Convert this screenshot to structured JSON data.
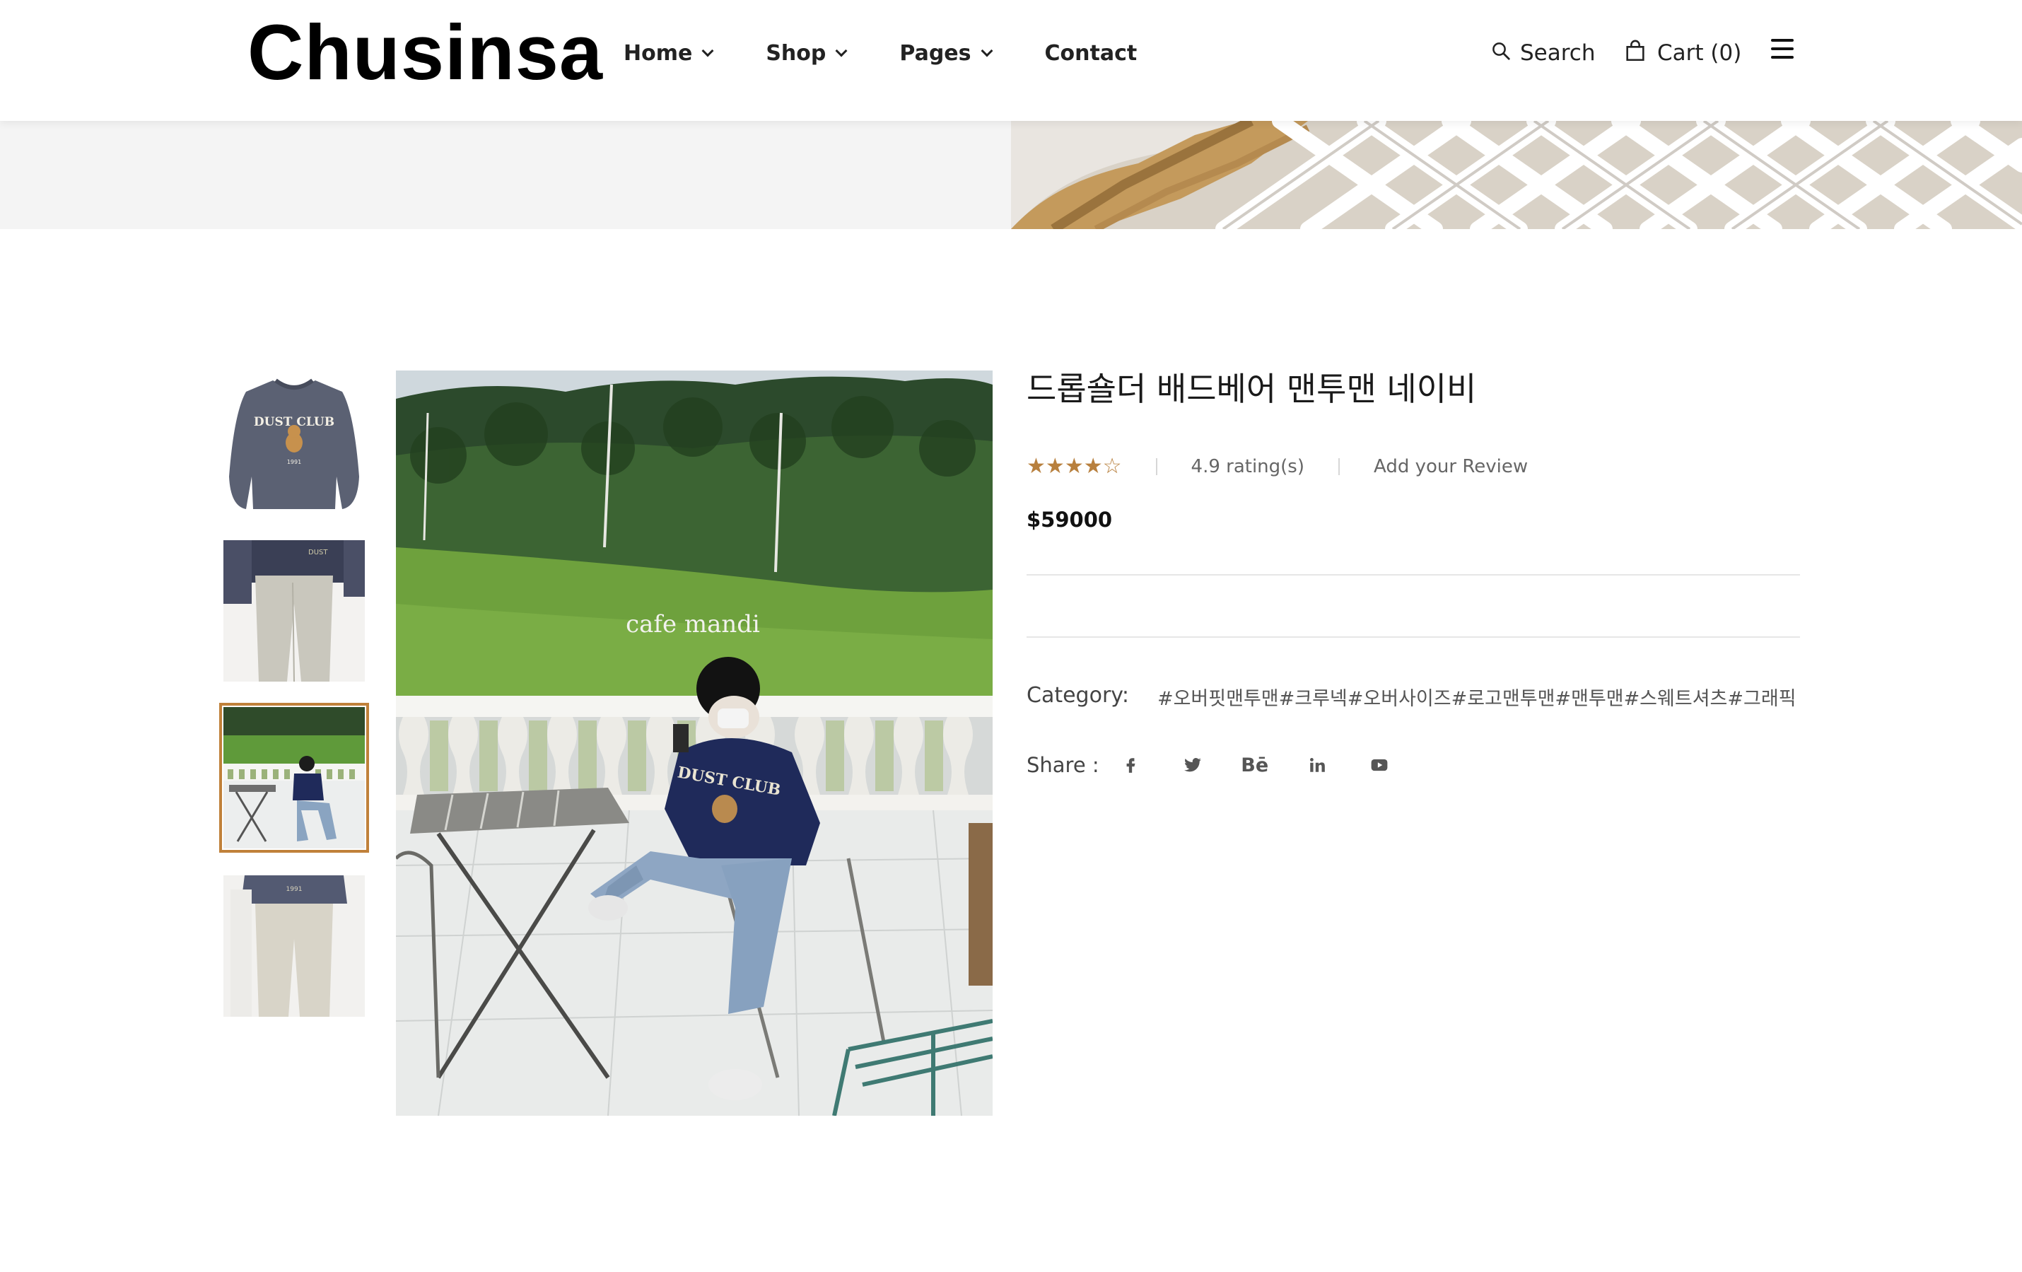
{
  "header": {
    "logo": "Chusinsa",
    "nav": [
      {
        "label": "Home",
        "has_dropdown": true
      },
      {
        "label": "Shop",
        "has_dropdown": true
      },
      {
        "label": "Pages",
        "has_dropdown": true
      },
      {
        "label": "Contact",
        "has_dropdown": false
      }
    ],
    "search_label": "Search",
    "cart_label": "Cart (0)",
    "icons": {
      "search": "search-icon",
      "cart": "shopping-bag-icon",
      "menu": "hamburger-menu-icon"
    }
  },
  "product": {
    "title": "드롭숄더 배드베어 맨투맨 네이비",
    "stars_filled": 4,
    "stars_total": 5,
    "rating_text": "4.9 rating(s)",
    "add_review": "Add your Review",
    "price": "$59000",
    "category_label": "Category:",
    "category_value": "#오버핏맨투맨#크루넥#오버사이즈#로고맨투맨#맨투맨#스웨트셔츠#그래픽",
    "share_label": "Share :",
    "share_icons": [
      "facebook-icon",
      "twitter-icon",
      "behance-icon",
      "linkedin-icon",
      "youtube-icon"
    ],
    "behance_text": "Bē"
  },
  "gallery": {
    "thumbnails": [
      "sweatshirt-front",
      "model-pants",
      "model-outdoor-cafe",
      "model-standing"
    ],
    "active_index": 2,
    "main_image_sign": "cafe mandi"
  },
  "colors": {
    "accent": "#c0813a",
    "star": "#b8803e",
    "navy": "#1f2a5a"
  }
}
